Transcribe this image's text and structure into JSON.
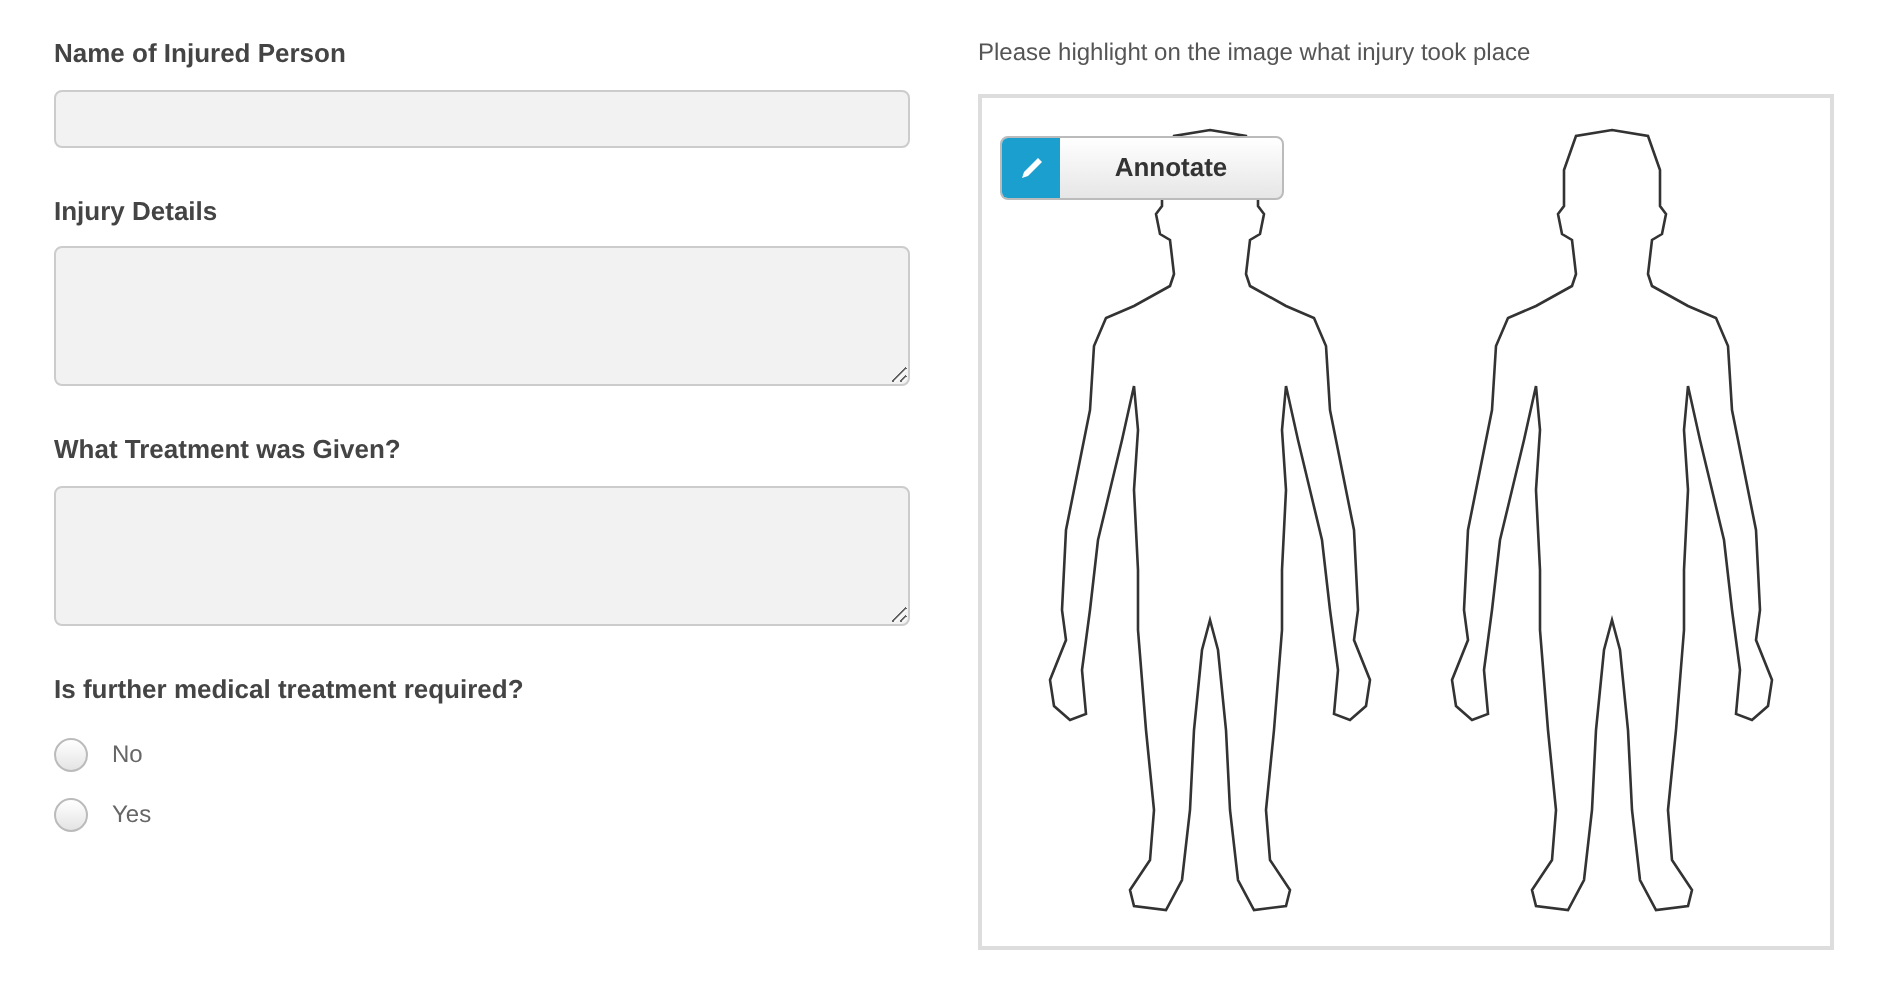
{
  "fields": [
    {
      "label": "Name of Injured Person",
      "kind": "text"
    },
    {
      "label": "Injury Details",
      "kind": "textarea"
    },
    {
      "label": "What Treatment was Given?",
      "kind": "textarea"
    }
  ],
  "question": {
    "label": "Is further medical treatment required?",
    "options": [
      {
        "label": "No",
        "selected": false
      },
      {
        "label": "Yes",
        "selected": false
      }
    ]
  },
  "image_panel": {
    "prompt": "Please highlight on the image what injury took place",
    "annotate_button": "Annotate"
  }
}
